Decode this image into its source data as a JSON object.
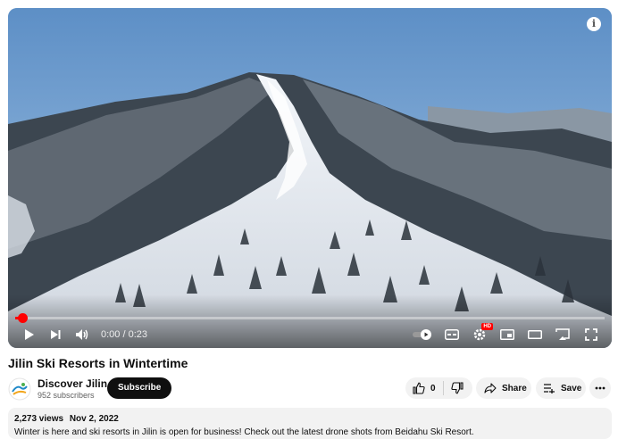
{
  "player": {
    "time_display": "0:00 / 0:23",
    "progress_fraction": 0.02,
    "hd_badge": "HD",
    "info_glyph": "i",
    "icons": [
      "play-icon",
      "next-icon",
      "volume-icon",
      "autoplay-toggle-icon",
      "captions-icon",
      "settings-icon",
      "miniplayer-icon",
      "theater-icon",
      "cast-icon",
      "fullscreen-icon",
      "info-icon"
    ]
  },
  "video": {
    "title": "Jilin Ski Resorts in Wintertime"
  },
  "channel": {
    "name": "Discover Jilin",
    "subscribers": "952 subscribers",
    "subscribe_label": "Subscribe"
  },
  "actions": {
    "like_count": "0",
    "share_label": "Share",
    "save_label": "Save"
  },
  "description": {
    "views": "2,273 views",
    "date": "Nov 2, 2022",
    "text": "Winter is here and ski resorts in Jilin is open for business! Check out the latest drone shots from Beidahu Ski Resort."
  },
  "colors": {
    "progress": "#ff0000",
    "subscribe_bg": "#0f0f0f",
    "pill_bg": "#f2f2f2"
  }
}
